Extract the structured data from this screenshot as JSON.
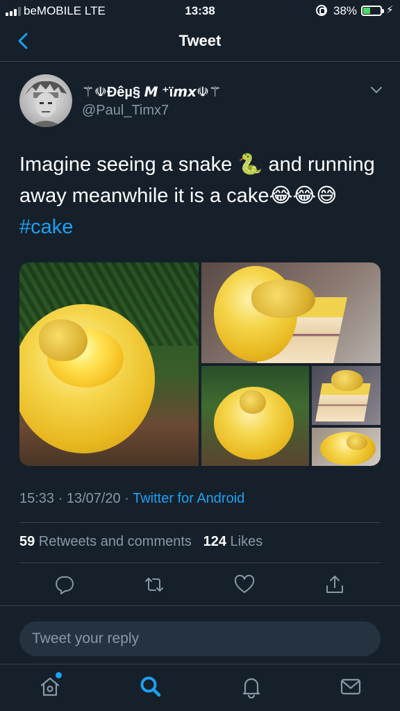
{
  "status_bar": {
    "carrier": "beMOBILE  LTE",
    "time": "13:38",
    "battery_percent": "38%",
    "battery_level": 0.38
  },
  "nav": {
    "title": "Tweet",
    "back_icon": "chevron-left-icon"
  },
  "tweet": {
    "display_name": "⚚☫Đêµ§ 𝙈 ⁺ï𝙢𝙭☫⚚",
    "handle": "@Paul_Timx7",
    "text_line1": "Imagine seeing a snake 🐍 and running",
    "text_line2": "away meanwhile it is a cake😂😂😅",
    "hashtag": "#cake",
    "timestamp": "15:33 · 13/07/20 · ",
    "source": "Twitter for Android",
    "retweets_count": "59",
    "retweets_label": " Retweets and comments",
    "likes_count": "124",
    "likes_label": " Likes"
  },
  "actions": [
    "reply-icon",
    "retweet-icon",
    "like-icon",
    "share-icon"
  ],
  "reply_box": {
    "placeholder": "Tweet your reply"
  },
  "tab_bar": [
    "home-icon",
    "search-icon",
    "notifications-icon",
    "messages-icon"
  ],
  "colors": {
    "background": "#15202b",
    "accent": "#1da1f2",
    "secondary_text": "#8899a6",
    "divider": "#38444d"
  }
}
